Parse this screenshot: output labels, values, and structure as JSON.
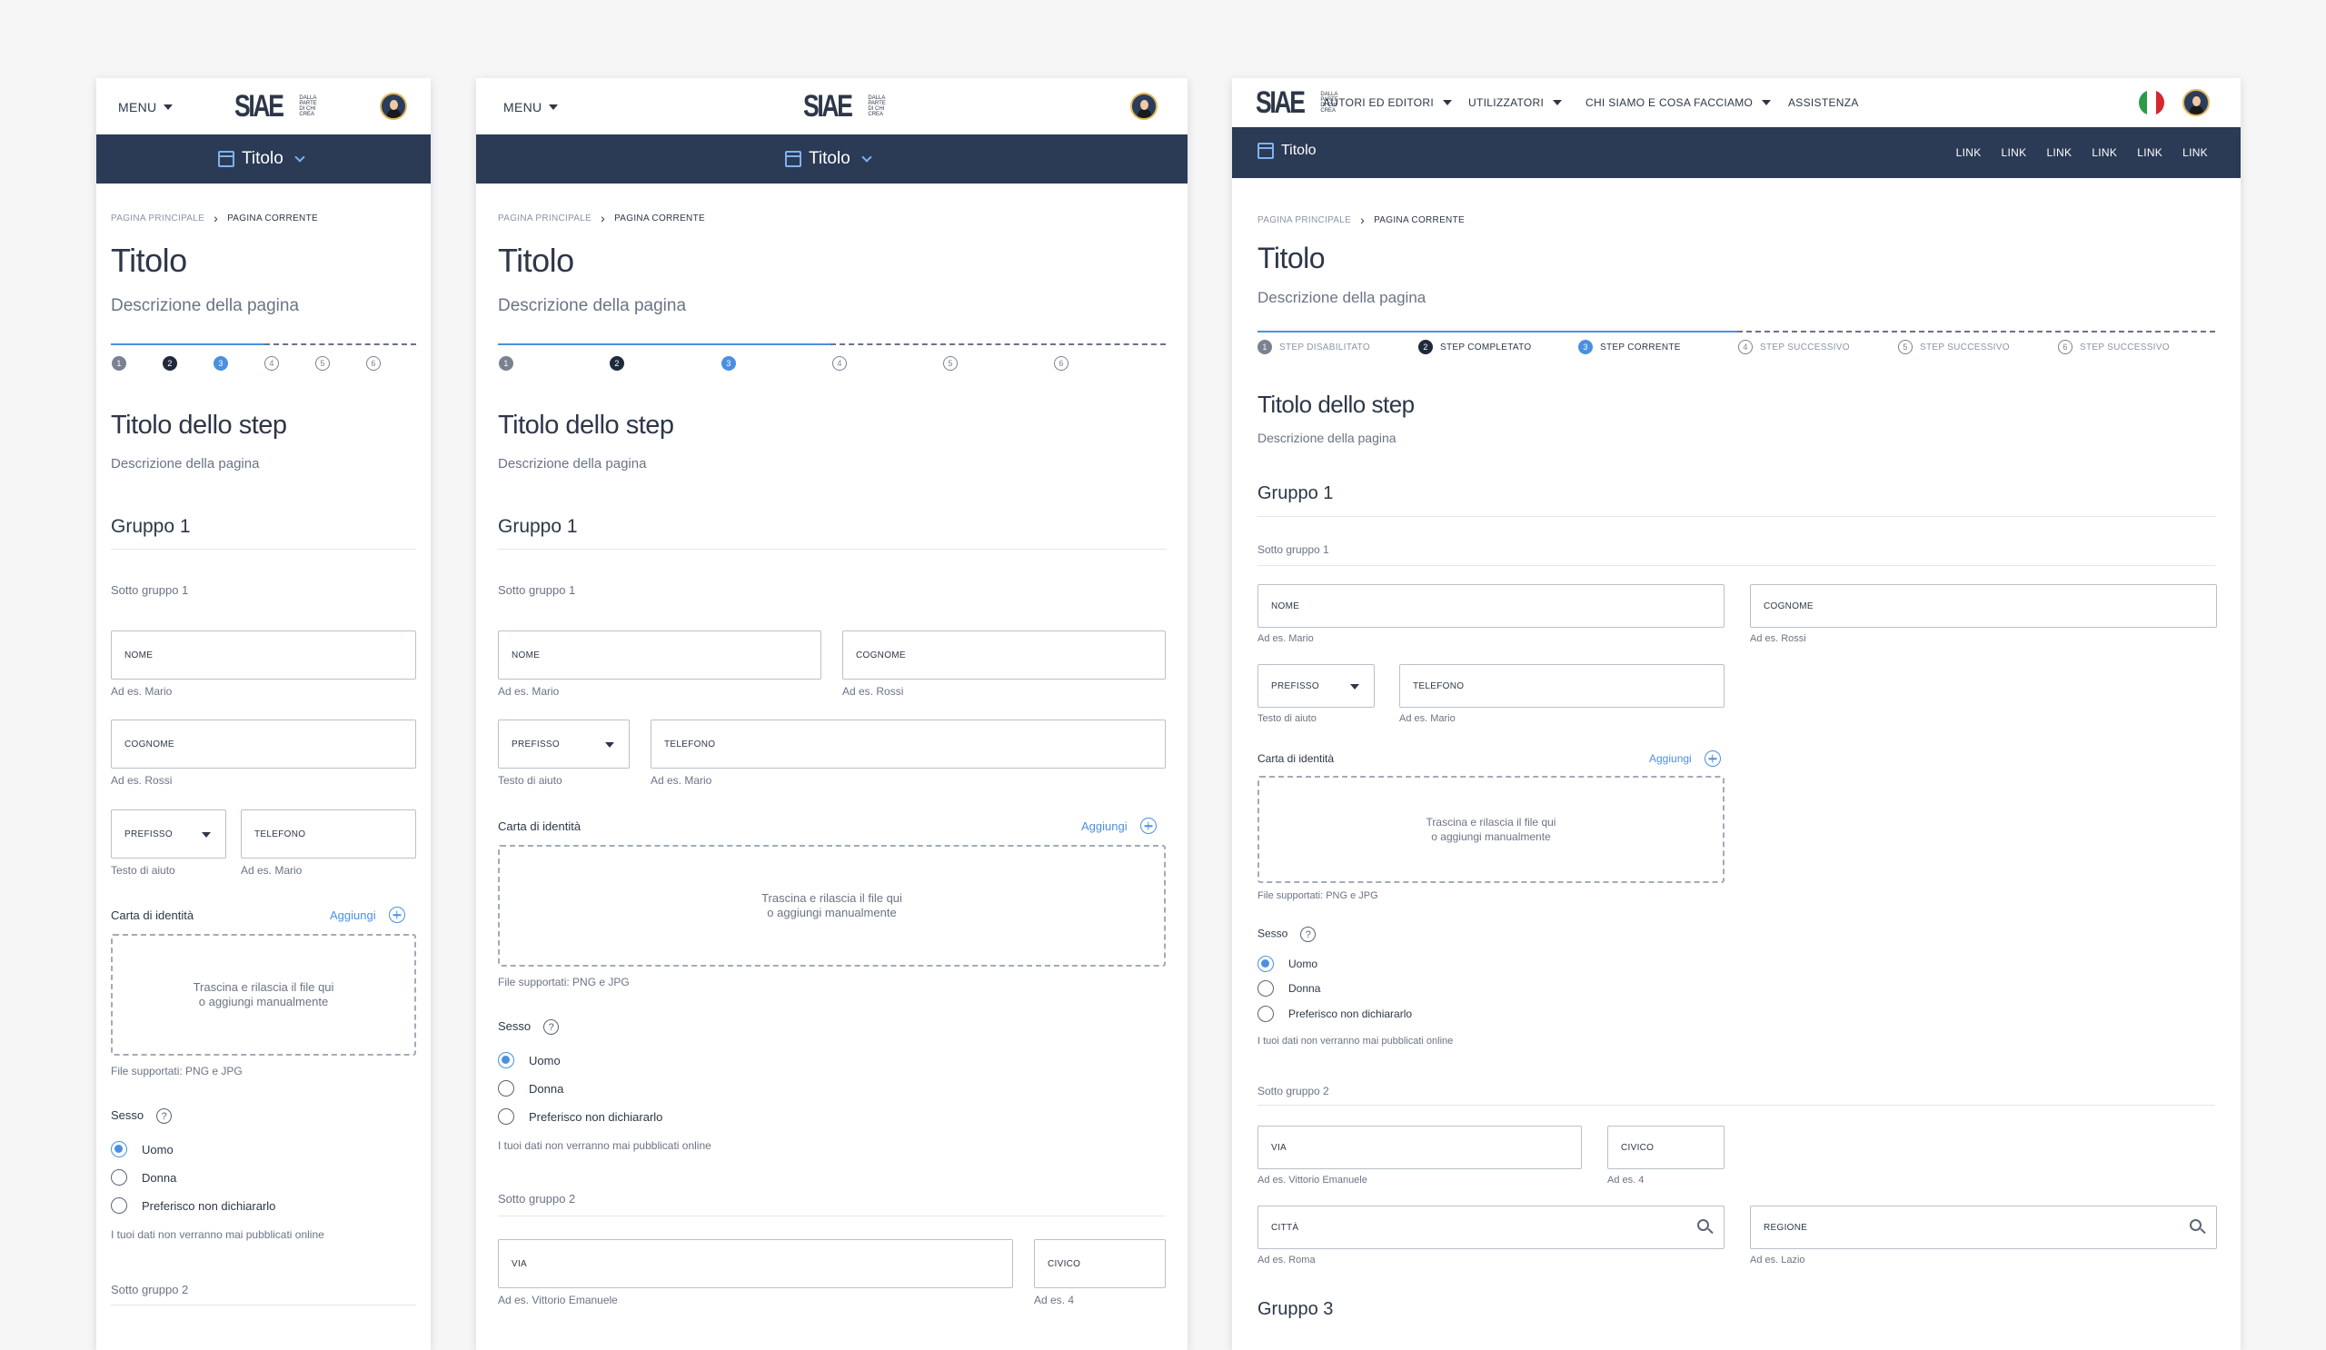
{
  "brand": {
    "logo": "SIAE",
    "tagline": [
      "DALLA",
      "PARTE",
      "DI CHI",
      "CREA"
    ]
  },
  "menu_label": "MENU",
  "title": "Titolo",
  "breadcrumb": {
    "home": "PAGINA PRINCIPALE",
    "current": "PAGINA CORRENTE"
  },
  "page": {
    "title": "Titolo",
    "description": "Descrizione della pagina"
  },
  "stepper": {
    "numbers": [
      "1",
      "2",
      "3",
      "4",
      "5",
      "6"
    ],
    "labels": [
      "STEP DISABILITATO",
      "STEP COMPLETATO",
      "STEP CORRENTE",
      "STEP SUCCESSIVO",
      "STEP SUCCESSIVO",
      "STEP SUCCESSIVO"
    ],
    "current": 3
  },
  "step": {
    "title": "Titolo dello step",
    "description": "Descrizione della pagina"
  },
  "group1": {
    "title": "Gruppo 1",
    "subgroup1": "Sotto gruppo 1",
    "subgroup2": "Sotto gruppo 2"
  },
  "fields": {
    "nome": {
      "label": "NOME",
      "hint": "Ad es. Mario"
    },
    "cognome": {
      "label": "COGNOME",
      "hint": "Ad es. Rossi"
    },
    "prefisso": {
      "label": "PREFISSO",
      "hint": "Testo di aiuto"
    },
    "telefono": {
      "label": "TELEFONO",
      "hint": "Ad es. Mario"
    },
    "via": {
      "label": "VIA",
      "hint": "Ad es. Vittorio Emanuele"
    },
    "civico": {
      "label": "CIVICO",
      "hint": "Ad es. 4"
    },
    "citta": {
      "label": "CITTÀ",
      "hint": "Ad es. Roma"
    },
    "regione": {
      "label": "REGIONE",
      "hint": "Ad es. Lazio"
    }
  },
  "upload": {
    "label": "Carta di identità",
    "add": "Aggiungi",
    "drop_line1": "Trascina e rilascia il file qui",
    "drop_line2": "o aggiungi manualmente",
    "supported": "File supportati: PNG e JPG"
  },
  "sesso": {
    "label": "Sesso",
    "help": "?",
    "options": [
      "Uomo",
      "Donna",
      "Preferisco non dichiararlo"
    ],
    "selected": "Uomo",
    "note": "I tuoi dati non verranno mai pubblicati online"
  },
  "desktop_nav": [
    "AUTORI ED EDITORI",
    "UTILIZZATORI",
    "CHI SIAMO E COSA FACCIAMO",
    "ASSISTENZA"
  ],
  "desktop_links": [
    "LINK",
    "LINK",
    "LINK",
    "LINK",
    "LINK",
    "LINK"
  ],
  "group3_partial": "Gruppo 3",
  "colors": {
    "dark": "#2b3a55",
    "accent": "#4a90e2",
    "flag": [
      "#2e9a48",
      "#ffffff",
      "#d6262f"
    ]
  }
}
